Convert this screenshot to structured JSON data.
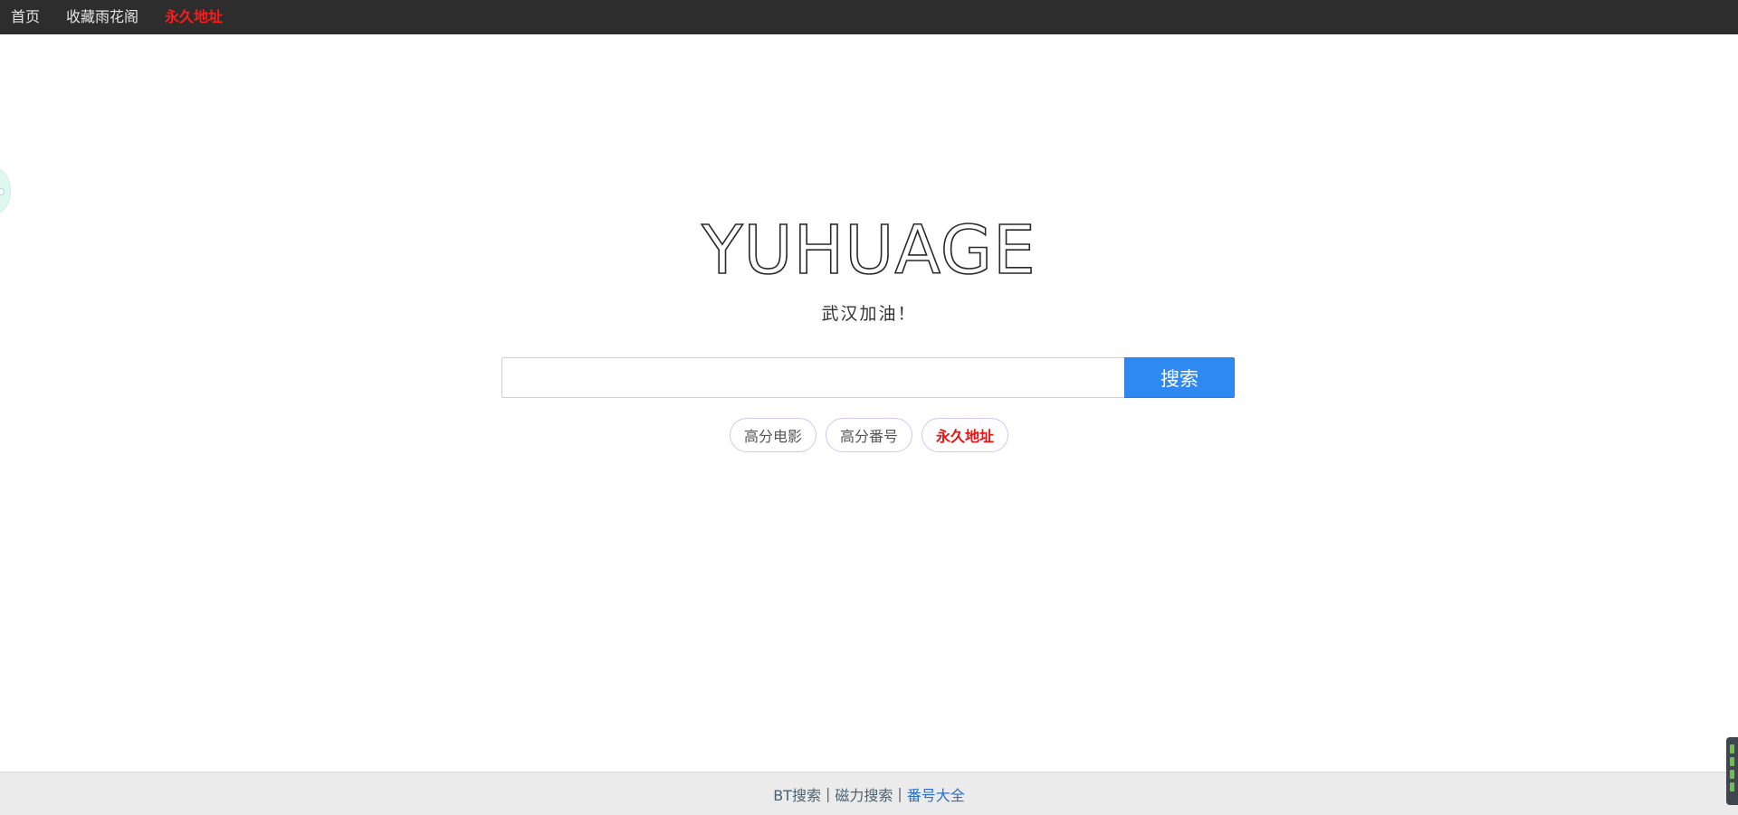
{
  "nav": {
    "items": [
      {
        "label": "首页"
      },
      {
        "label": "收藏雨花阁"
      },
      {
        "label": "永久地址"
      }
    ]
  },
  "logo": {
    "text": "YUHUAGE"
  },
  "tagline": {
    "text": "武汉加油！"
  },
  "search": {
    "value": "",
    "placeholder": "",
    "button_label": "搜索"
  },
  "tags": [
    {
      "label": "高分电影"
    },
    {
      "label": "高分番号"
    },
    {
      "label": "永久地址"
    }
  ],
  "footer": {
    "link1": "BT搜索",
    "sep": "|",
    "link2": "磁力搜索",
    "link3": "番号大全"
  },
  "colors": {
    "navbar_bg": "#2d2d2d",
    "accent_red": "#ff1a1a",
    "search_button": "#2e89f3",
    "footer_bg": "#ebebeb"
  }
}
